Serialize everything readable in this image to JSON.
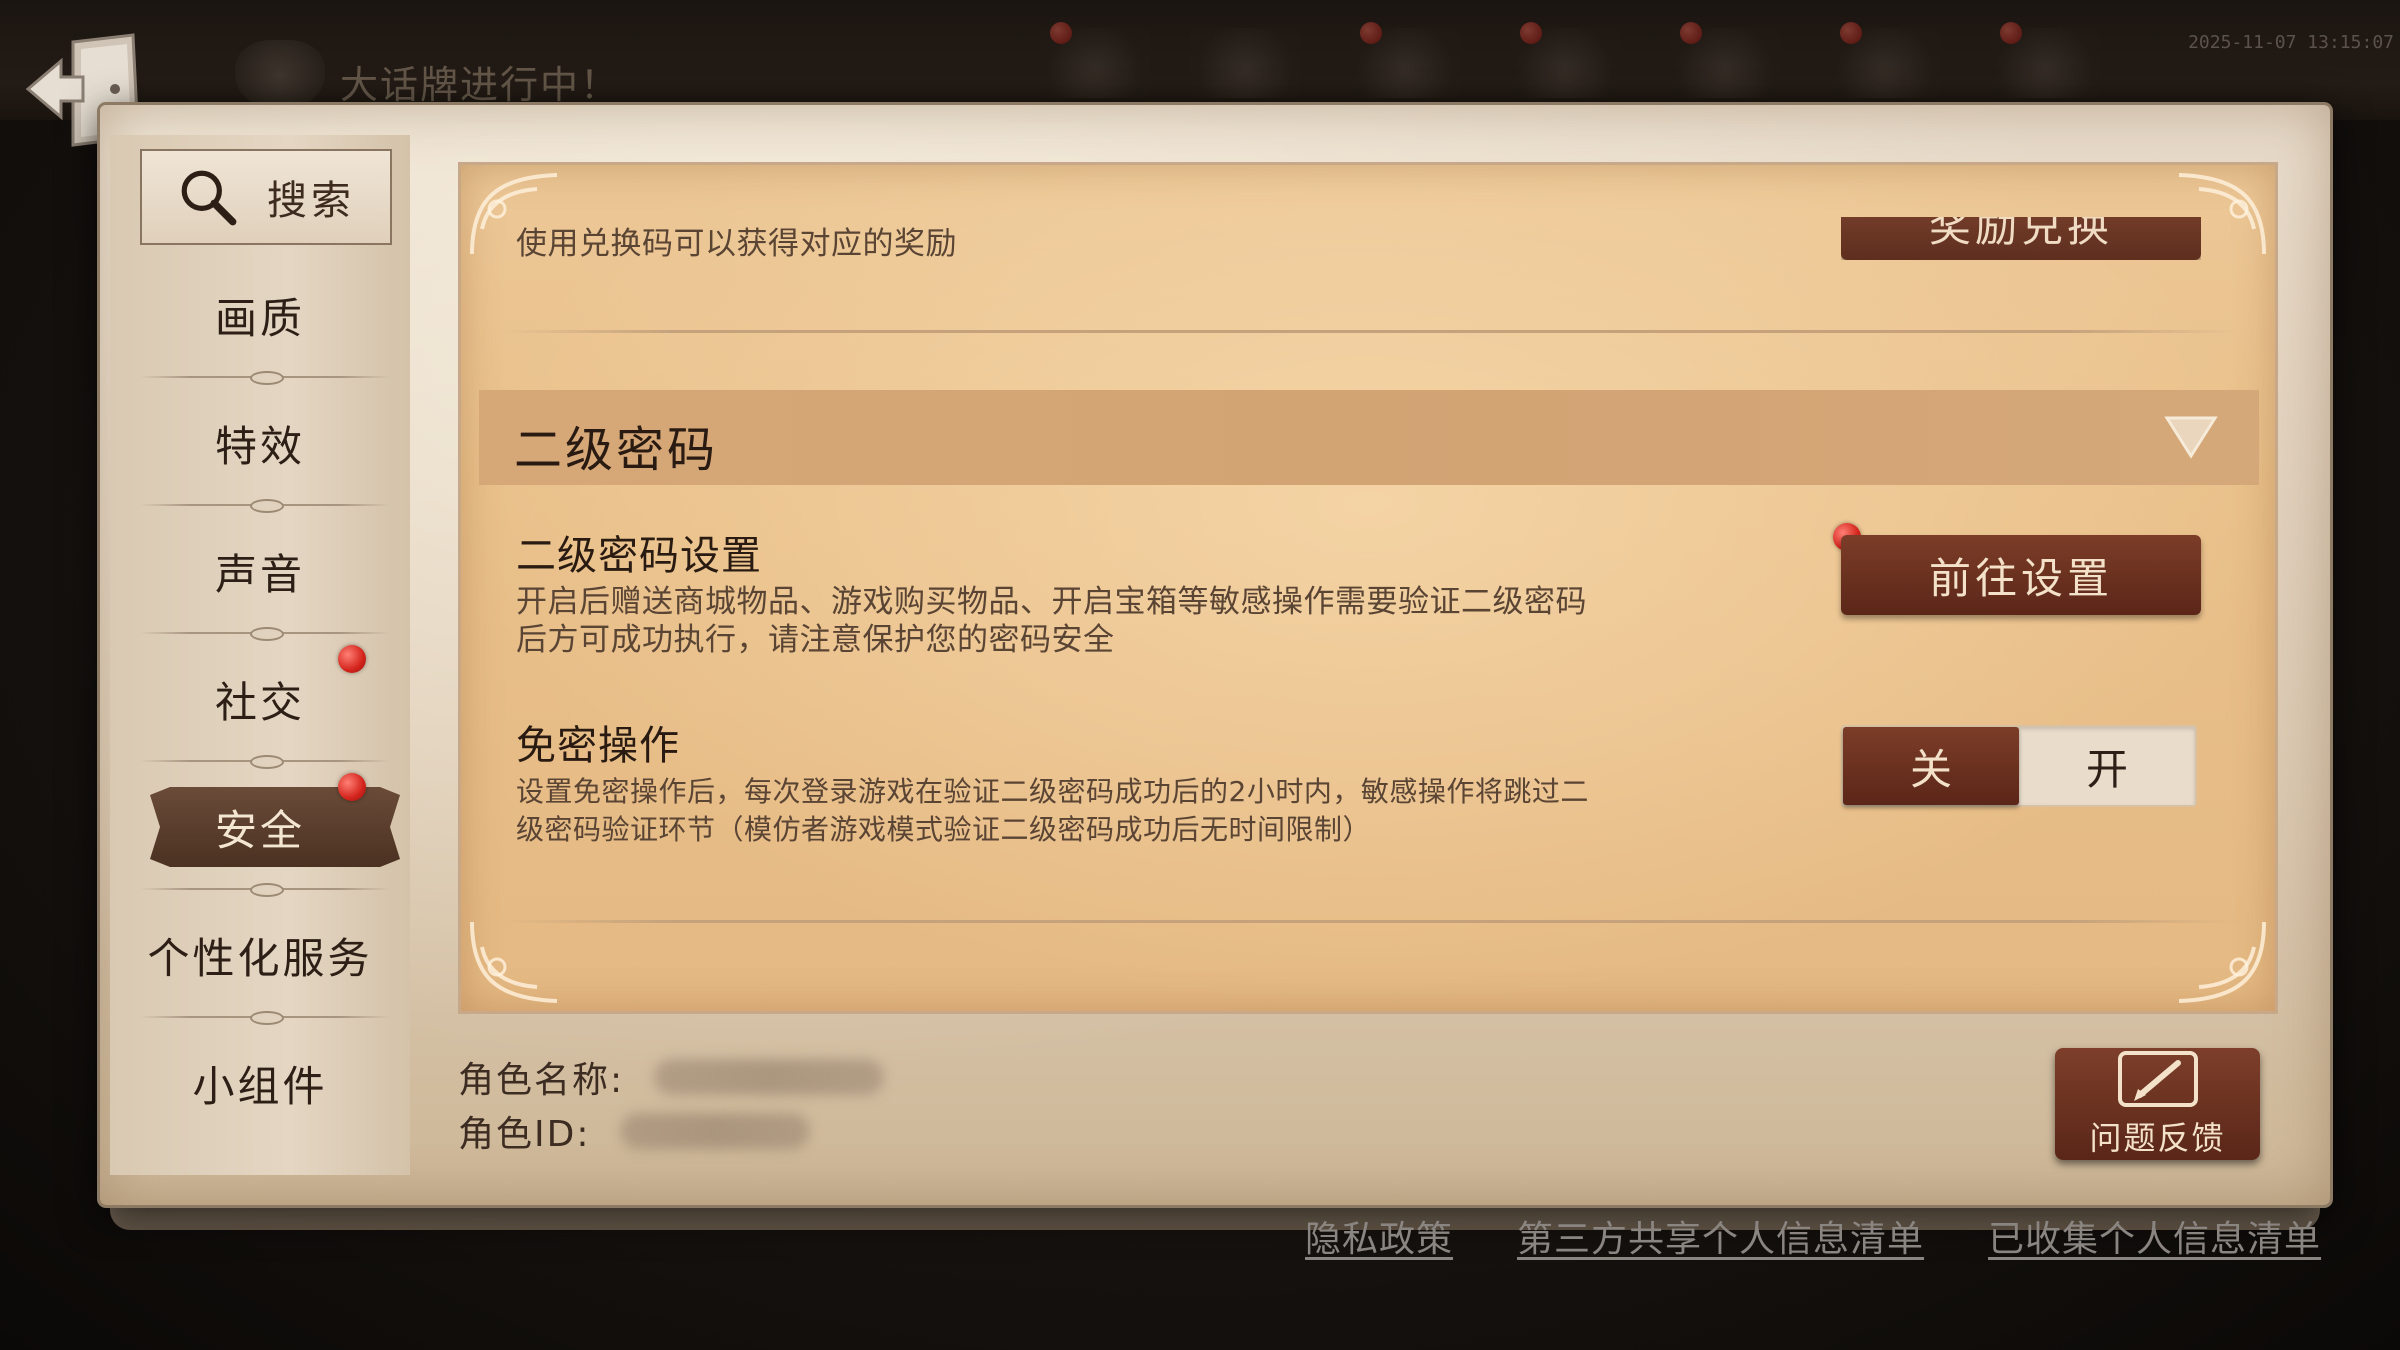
{
  "header": {
    "banner_text": "大话牌进行中！",
    "timestamp": "2025-11-07 13:15:07"
  },
  "sidebar": {
    "search_label": "搜索",
    "items": [
      {
        "label": "画质"
      },
      {
        "label": "特效"
      },
      {
        "label": "声音"
      },
      {
        "label": "社交"
      },
      {
        "label": "安全"
      },
      {
        "label": "个性化服务"
      },
      {
        "label": "小组件"
      }
    ],
    "active_item": "安全"
  },
  "redeem": {
    "description": "使用兑换码可以获得对应的奖励",
    "button_label": "奖励兑换"
  },
  "section": {
    "title": "二级密码"
  },
  "password_setting": {
    "title": "二级密码设置",
    "description": "开启后赠送商城物品、游戏购买物品、开启宝箱等敏感操作需要验证二级密码后方可成功执行，请注意保护您的密码安全",
    "button_label": "前往设置"
  },
  "free_operation": {
    "title": "免密操作",
    "description": "设置免密操作后，每次登录游戏在验证二级密码成功后的2小时内，敏感操作将跳过二级密码验证环节（模仿者游戏模式验证二级密码成功后无时间限制）",
    "toggle_off_label": "关",
    "toggle_on_label": "开",
    "selected": "关"
  },
  "role": {
    "name_label": "角色名称:",
    "id_label": "角色ID:"
  },
  "feedback": {
    "label": "问题反馈"
  },
  "footer": {
    "privacy_policy": "隐私政策",
    "third_party_list": "第三方共享个人信息清单",
    "collected_list": "已收集个人信息清单"
  },
  "colors": {
    "accent_button": "#6b2f1f",
    "notification_dot": "#d3241c",
    "card_background": "#e9c08a"
  }
}
